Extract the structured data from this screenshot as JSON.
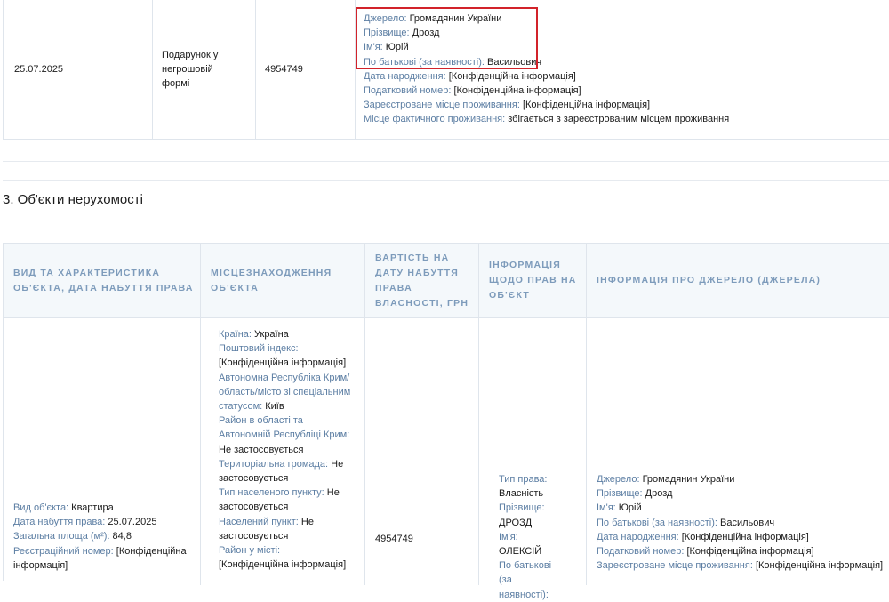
{
  "gift_row": {
    "date": "25.07.2025",
    "type": "Подарунок у негрошовій формі",
    "amount": "4954749",
    "source": [
      {
        "label": "Джерело:",
        "value": "Громадянин України"
      },
      {
        "label": "Прізвище:",
        "value": "Дрозд"
      },
      {
        "label": "Ім'я:",
        "value": "Юрій"
      },
      {
        "label": "По батькові (за наявності):",
        "value": "Васильович"
      },
      {
        "label": "Дата народження:",
        "value": "[Конфіденційна інформація]"
      },
      {
        "label": "Податковий номер:",
        "value": "[Конфіденційна інформація]"
      },
      {
        "label": "Зареєстроване місце проживання:",
        "value": "[Конфіденційна інформація]"
      },
      {
        "label": "Місце фактичного проживання:",
        "value": "збігається з зареєстрованим місцем проживання"
      }
    ],
    "highlight_color": "#d2232a"
  },
  "section": {
    "title": "3. Об'єкти нерухомості"
  },
  "property_table": {
    "headers": [
      "Вид та характеристика об'єкта, дата набуття права",
      "Місцезнаходження об'єкта",
      "Вартість на дату набуття права власності, грн",
      "Інформація щодо прав на об'єкт",
      "Інформація про джерело (джерела)"
    ],
    "row": {
      "object": [
        {
          "label": "Вид об'єкта:",
          "value": "Квартира"
        },
        {
          "label": "Дата набуття права:",
          "value": "25.07.2025"
        },
        {
          "label": "Загальна площа (м²):",
          "value": "84,8"
        },
        {
          "label": "Реєстраційний номер:",
          "value": "[Конфіденційна інформація]"
        }
      ],
      "location": [
        {
          "label": "Країна:",
          "value": "Україна"
        },
        {
          "label": "Поштовий індекс:",
          "value": "[Конфіденційна інформація]"
        },
        {
          "label": "Автономна Республіка Крим/ область/місто зі спеціальним статусом:",
          "value": "Київ"
        },
        {
          "label": "Район в області та Автономній Республіці Крим:",
          "value": "Не застосовується"
        },
        {
          "label": "Територіальна громада:",
          "value": "Не застосовується"
        },
        {
          "label": "Тип населеного пункту:",
          "value": "Не застосовується"
        },
        {
          "label": "Населений пункт:",
          "value": "Не застосовується"
        },
        {
          "label": "Район у місті:",
          "value": "[Конфіденційна інформація]"
        }
      ],
      "value": "4954749",
      "rights": [
        {
          "label": "Тип права:",
          "value": "Власність"
        },
        {
          "label": "Прізвище:",
          "value": "ДРОЗД"
        },
        {
          "label": "Ім'я:",
          "value": "ОЛЕКСІЙ"
        },
        {
          "label": "По батькові (за наявності):",
          "value": ""
        }
      ],
      "source": [
        {
          "label": "Джерело:",
          "value": "Громадянин України"
        },
        {
          "label": "Прізвище:",
          "value": "Дрозд"
        },
        {
          "label": "Ім'я:",
          "value": "Юрій"
        },
        {
          "label": "По батькові (за наявності):",
          "value": "Васильович"
        },
        {
          "label": "Дата народження:",
          "value": "[Конфіденційна інформація]"
        },
        {
          "label": "Податковий номер:",
          "value": "[Конфіденційна інформація]"
        },
        {
          "label": "Зареєстроване місце проживання:",
          "value": "[Конфіденційна інформація]"
        }
      ]
    }
  }
}
